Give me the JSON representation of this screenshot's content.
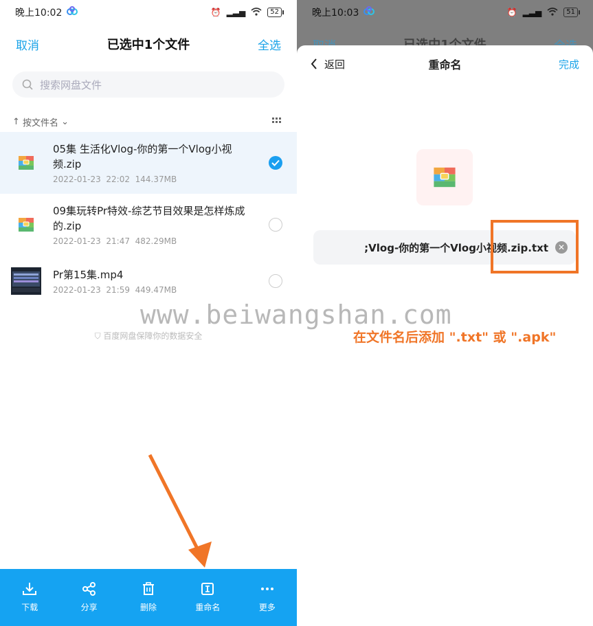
{
  "left": {
    "status": {
      "time": "晚上10:02",
      "signal": "4G",
      "battery": "52"
    },
    "nav": {
      "cancel": "取消",
      "title": "已选中1个文件",
      "select_all": "全选"
    },
    "search_placeholder": "搜索网盘文件",
    "sort_label": "按文件名",
    "files": [
      {
        "name": "05集 生活化Vlog-你的第一个Vlog小视频.zip",
        "date": "2022-01-23",
        "time": "22:02",
        "size": "144.37MB",
        "selected": true
      },
      {
        "name": "09集玩转Pr特效-综艺节目效果是怎样炼成的.zip",
        "date": "2022-01-23",
        "time": "21:47",
        "size": "482.29MB",
        "selected": false
      },
      {
        "name": "Pr第15集.mp4",
        "date": "2022-01-23",
        "time": "21:59",
        "size": "449.47MB",
        "selected": false
      }
    ],
    "safe_text": "百度网盘保障你的数据安全",
    "toolbar": [
      {
        "label": "下载",
        "icon": "download-icon"
      },
      {
        "label": "分享",
        "icon": "share-icon"
      },
      {
        "label": "删除",
        "icon": "trash-icon"
      },
      {
        "label": "重命名",
        "icon": "rename-icon"
      },
      {
        "label": "更多",
        "icon": "more-icon"
      }
    ]
  },
  "right": {
    "status": {
      "time": "晚上10:03",
      "battery": "51"
    },
    "bg_nav": {
      "cancel": "取消",
      "title": "已选中1个文件",
      "select_all": "全选"
    },
    "nav": {
      "back": "返回",
      "title": "重命名",
      "done": "完成"
    },
    "input_value": ";Vlog-你的第一个Vlog小视频.zip.txt",
    "hint": "在文件名后添加 \".txt\" 或 \".apk\""
  },
  "watermark": "www.beiwangshan.com",
  "colors": {
    "accent": "#1aa3e8",
    "toolbar": "#15a3f2",
    "highlight": "#f07527"
  }
}
